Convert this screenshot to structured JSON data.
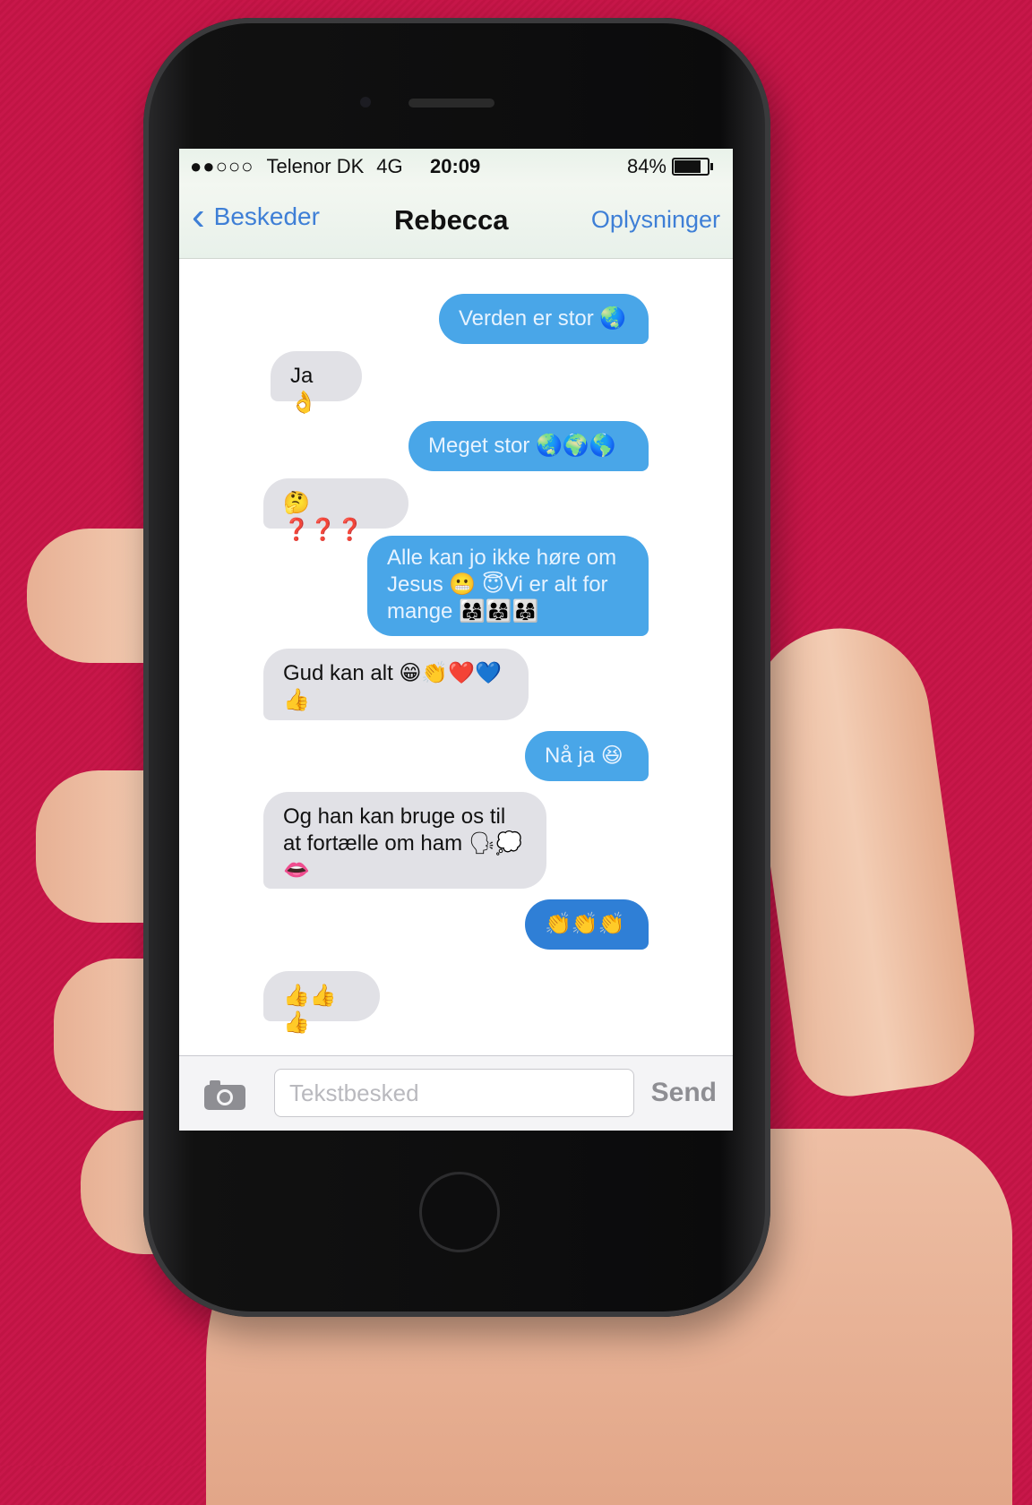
{
  "status": {
    "carrier": "Telenor DK",
    "network": "4G",
    "time": "20:09",
    "battery": "84%",
    "battery_level": 0.84
  },
  "nav": {
    "back_label": "Beskeder",
    "title": "Rebecca",
    "info_label": "Oplysninger"
  },
  "messages": [
    {
      "direction": "outgoing",
      "text": "Verden er stor 🌏"
    },
    {
      "direction": "incoming",
      "text": "Ja 👌"
    },
    {
      "direction": "outgoing",
      "text": "Meget stor 🌏🌍🌎"
    },
    {
      "direction": "incoming",
      "text": "🤔❓❓❓"
    },
    {
      "direction": "outgoing",
      "text": "Alle kan jo ikke høre om Jesus 😬 😇Vi er alt for mange 👨‍👩‍👧👨‍👩‍👧👨‍👩‍👧"
    },
    {
      "direction": "incoming",
      "text": "Gud kan alt 😁👏❤️💙👍"
    },
    {
      "direction": "outgoing",
      "text": "Nå ja 😆"
    },
    {
      "direction": "incoming",
      "text": "Og han kan bruge os til at fortælle om ham 🗣💭👄"
    },
    {
      "direction": "outgoing",
      "text": "👏👏👏"
    },
    {
      "direction": "incoming",
      "text": "👍👍👍"
    }
  ],
  "composer": {
    "placeholder": "Tekstbesked",
    "send_label": "Send"
  },
  "colors": {
    "background": "#c8174a",
    "outgoing_bubble": "#49a6e8",
    "incoming_bubble": "#e1e1e6",
    "accent": "#3e7fd6"
  }
}
